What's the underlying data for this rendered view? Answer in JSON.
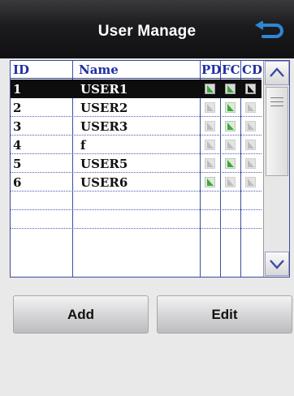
{
  "header": {
    "title": "User Manage",
    "back_icon": "return-arrow-icon"
  },
  "table": {
    "columns": {
      "id": "ID",
      "name": "Name",
      "pd": "PD",
      "fc": "FC",
      "cd": "CD"
    },
    "rows": [
      {
        "id": "1",
        "name": "USER1",
        "selected": true,
        "pd": true,
        "fc": true,
        "cd": "black"
      },
      {
        "id": "2",
        "name": "USER2",
        "selected": false,
        "pd": false,
        "fc": true,
        "cd": false
      },
      {
        "id": "3",
        "name": "USER3",
        "selected": false,
        "pd": false,
        "fc": true,
        "cd": false
      },
      {
        "id": "4",
        "name": "f",
        "selected": false,
        "pd": false,
        "fc": false,
        "cd": false
      },
      {
        "id": "5",
        "name": "USER5",
        "selected": false,
        "pd": false,
        "fc": true,
        "cd": false
      },
      {
        "id": "6",
        "name": "USER6",
        "selected": false,
        "pd": true,
        "fc": false,
        "cd": false
      },
      {
        "id": "",
        "name": "",
        "selected": false,
        "pd": null,
        "fc": null,
        "cd": null
      },
      {
        "id": "",
        "name": "",
        "selected": false,
        "pd": null,
        "fc": null,
        "cd": null
      }
    ]
  },
  "scrollbar": {
    "up_icon": "chevron-up-icon",
    "down_icon": "chevron-down-icon"
  },
  "buttons": {
    "add": "Add",
    "edit": "Edit"
  },
  "colors": {
    "accent": "#1f2fa2",
    "selection": "#0d0d0d",
    "permission_on": "#3da83a",
    "back_icon": "#2f86d6"
  }
}
